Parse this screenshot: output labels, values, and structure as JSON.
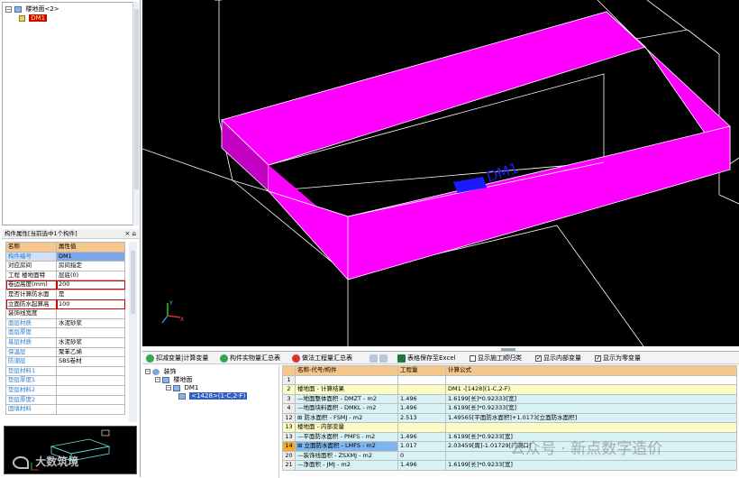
{
  "left_tree": {
    "items": [
      {
        "label": "楼地面<2>"
      },
      {
        "label": "DM1"
      }
    ]
  },
  "props": {
    "title": "构件属性[当前选中1个构件]",
    "headers": [
      "名称",
      "属性值"
    ],
    "rows": [
      {
        "name": "构件编号",
        "value": "DM1"
      },
      {
        "name": "对应房间",
        "value": "房间指定"
      },
      {
        "name": "工程  楼地面特",
        "value": "层底(0)"
      },
      {
        "name": "卷边高度(mm)",
        "value": "200"
      },
      {
        "name": "是否计算防水面",
        "value": "是"
      },
      {
        "name": "立面防水起算高",
        "value": "100"
      },
      {
        "name": "装饰线宽度",
        "value": ""
      },
      {
        "name": "面层材质",
        "value": "水泥砂浆"
      },
      {
        "name": "面层厚度",
        "value": ""
      },
      {
        "name": "基层材质",
        "value": "水泥砂浆"
      },
      {
        "name": "保温层",
        "value": "聚苯乙烯"
      },
      {
        "name": "防潮层",
        "value": "SBS卷材"
      },
      {
        "name": "垫层材料1",
        "value": ""
      },
      {
        "name": "垫层厚度1",
        "value": ""
      },
      {
        "name": "垫层材料2",
        "value": ""
      },
      {
        "name": "垫层厚度2",
        "value": ""
      },
      {
        "name": "固填材料",
        "value": ""
      }
    ]
  },
  "viewport": {
    "label": "DM1",
    "colors": {
      "background": "#000000",
      "walls": "#ff00ff",
      "wall_dark": "#c300c3",
      "lines": "#ffffff",
      "label": "#1a1aff"
    }
  },
  "toolbar": {
    "items": [
      "扣减变量|计算变量",
      "构件实物量汇总表",
      "做法工程量汇总表",
      "表格保存至Excel",
      "显示施工顺归类",
      "显示内部变量",
      "显示为零变量"
    ],
    "checks": [
      false,
      true,
      true
    ]
  },
  "bottom_tree": {
    "items": [
      {
        "label": "装饰"
      },
      {
        "label": "楼地面"
      },
      {
        "label": "DM1"
      },
      {
        "label": "<1428>(1-C,2-F)"
      }
    ]
  },
  "calc_table": {
    "headers": [
      "",
      "名称-代号/构件",
      "工程量",
      "计算公式"
    ],
    "rows": [
      {
        "num": "1",
        "name": "",
        "qty": "",
        "formula": "",
        "type": "blank"
      },
      {
        "num": "2",
        "name": "楼地面 - 计算结果",
        "qty": "",
        "formula": "DM1 -[1428](1-C,2-F)",
        "type": "grp"
      },
      {
        "num": "3",
        "name": "—地面整体面积 - DMZT - m2",
        "qty": "1.496",
        "formula": "1.6199[长]*0.92333[宽]",
        "type": "sub"
      },
      {
        "num": "4",
        "name": "—地面块料面积 - DMKL - m2",
        "qty": "1.496",
        "formula": "1.6199[长]*0.92333[宽]",
        "type": "sub"
      },
      {
        "num": "12",
        "name": "⊞ 防水面积 - FSMJ - m2",
        "qty": "2.513",
        "formula": "1.49565[平面防水面积]+1.0173[立面防水面积]",
        "type": "sub"
      },
      {
        "num": "13",
        "name": "楼地面 - 内部变量",
        "qty": "",
        "formula": "",
        "type": "grp"
      },
      {
        "num": "13",
        "name": "—平面防水面积 - PMFS - m2",
        "qty": "1.496",
        "formula": "1.6199[长]*0.9233[宽]",
        "type": "sub"
      },
      {
        "num": "14",
        "name": "⊞ 立面防水面积 - LMFS - m2",
        "qty": "1.017",
        "formula": "2.03459[周]-1.01729[门洞口]",
        "type": "sel"
      },
      {
        "num": "20",
        "name": "—装饰线面积 - ZSXMJ - m2",
        "qty": "0",
        "formula": "",
        "type": "sub"
      },
      {
        "num": "21",
        "name": "—净面积 - JMJ - m2",
        "qty": "1.496",
        "formula": "1.6199[长]*0.9233[宽]",
        "type": "sub"
      }
    ]
  },
  "watermark": "公众号 · 新点数字造价",
  "logo": "大数筑境"
}
